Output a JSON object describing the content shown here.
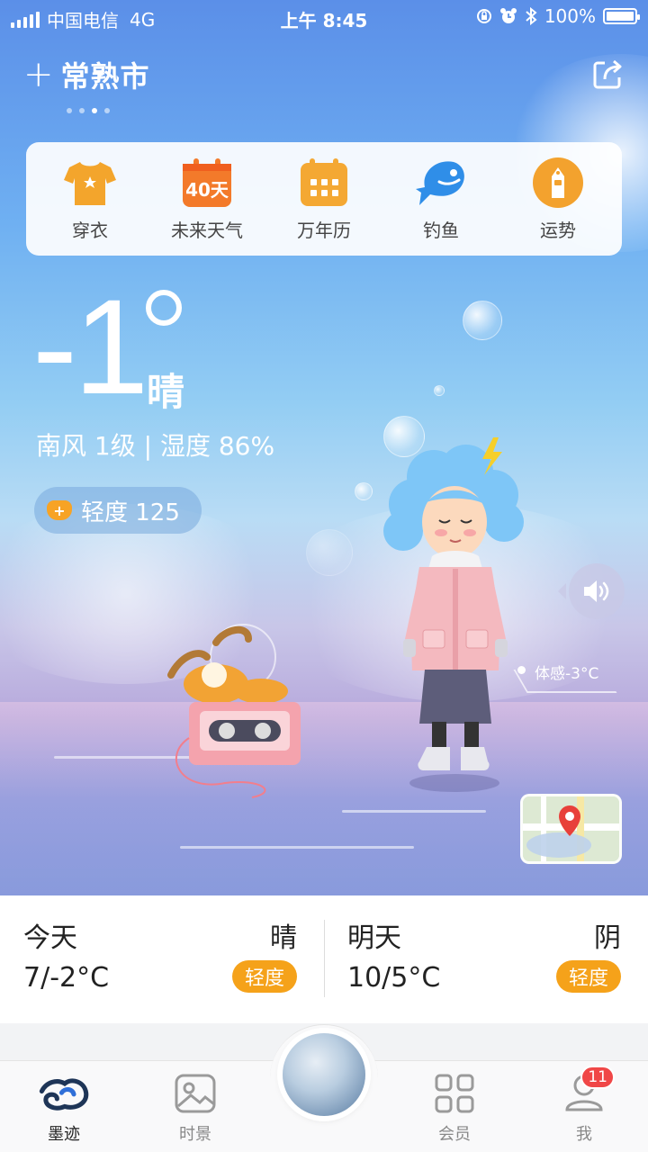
{
  "status_bar": {
    "carrier": "中国电信",
    "network": "4G",
    "time": "上午 8:45",
    "battery": "100%"
  },
  "header": {
    "add_symbol": "+",
    "city": "常熟市",
    "page_count": 4,
    "active_page": 3
  },
  "tools": [
    {
      "label": "穿衣",
      "icon": "shirt-icon"
    },
    {
      "label": "未来天气",
      "icon": "calendar-40-icon",
      "icon_text": "40天"
    },
    {
      "label": "万年历",
      "icon": "calendar-grid-icon"
    },
    {
      "label": "钓鱼",
      "icon": "fish-icon"
    },
    {
      "label": "运势",
      "icon": "fortune-icon"
    }
  ],
  "current": {
    "temperature": "-1",
    "condition": "晴",
    "wind_humidity": "南风 1级 | 湿度 86%",
    "aqi_label": "轻度 125",
    "aqi_badge": "+",
    "feels_like": "体感-3°C"
  },
  "forecast": [
    {
      "day": "今天",
      "weather": "晴",
      "range": "7/-2°C",
      "quality": "轻度"
    },
    {
      "day": "明天",
      "weather": "阴",
      "range": "10/5°C",
      "quality": "轻度"
    }
  ],
  "tabs": {
    "ink": "墨迹",
    "scenery": "时景",
    "member": "会员",
    "me": "我",
    "me_badge": "11"
  },
  "colors": {
    "accent": "#f5a21a",
    "badge_red": "#f04747",
    "sky_top": "#5b8fe8"
  }
}
